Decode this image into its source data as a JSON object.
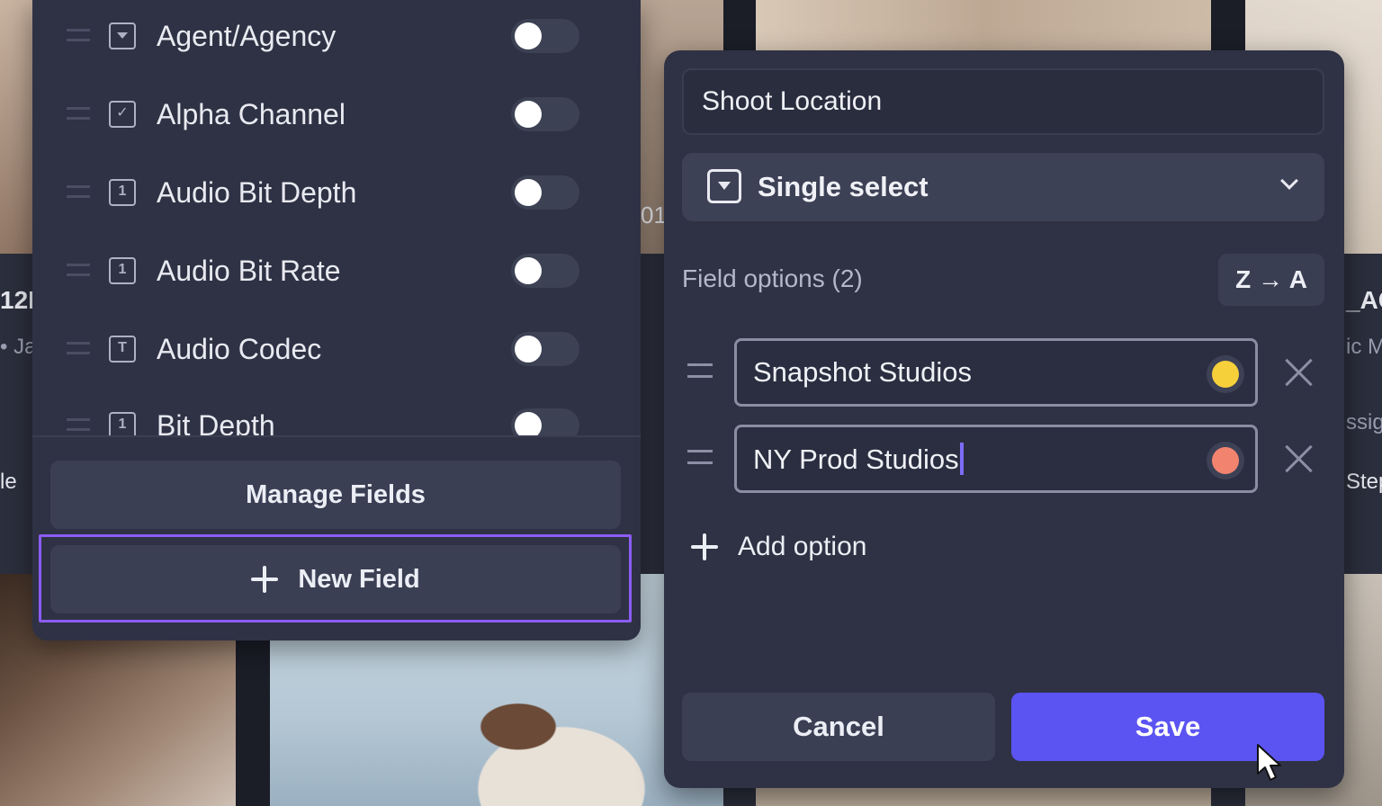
{
  "background": {
    "text_left_code": "12D",
    "text_left_sub": "• Ja",
    "text_left_tab": "le",
    "text_mid_code": "01",
    "text_right_code": "_AC",
    "text_right_sub1": "ic M",
    "text_right_sub2": "ssig",
    "text_right_sub3": "Step"
  },
  "fields_panel": {
    "items": [
      {
        "label": "Agent/Agency",
        "icon": "dropdown-field-icon",
        "enabled": false
      },
      {
        "label": "Alpha Channel",
        "icon": "checkbox-field-icon",
        "enabled": false
      },
      {
        "label": "Audio Bit Depth",
        "icon": "number-field-icon",
        "icon_text": "1",
        "enabled": false
      },
      {
        "label": "Audio Bit Rate",
        "icon": "number-field-icon",
        "icon_text": "1",
        "enabled": false
      },
      {
        "label": "Audio Codec",
        "icon": "text-field-icon",
        "icon_text": "T",
        "enabled": false
      },
      {
        "label": "Bit Depth",
        "icon": "number-field-icon",
        "icon_text": "1",
        "enabled": false
      }
    ],
    "checkbox_glyph": "✓",
    "manage_label": "Manage Fields",
    "new_field_label": "New Field"
  },
  "edit_panel": {
    "field_name": "Shoot Location",
    "type_label": "Single select",
    "options_title": "Field options (2)",
    "sort_label": "Z → A",
    "options": [
      {
        "label": "Snapshot Studios",
        "color": "#f5d03b"
      },
      {
        "label": "NY Prod Studios",
        "color": "#f2846f",
        "focused": true
      }
    ],
    "add_option_label": "Add option",
    "cancel_label": "Cancel",
    "save_label": "Save"
  },
  "colors": {
    "panel": "#2f3244",
    "accent": "#5b54f2",
    "focus_outline": "#8b5cf6"
  }
}
